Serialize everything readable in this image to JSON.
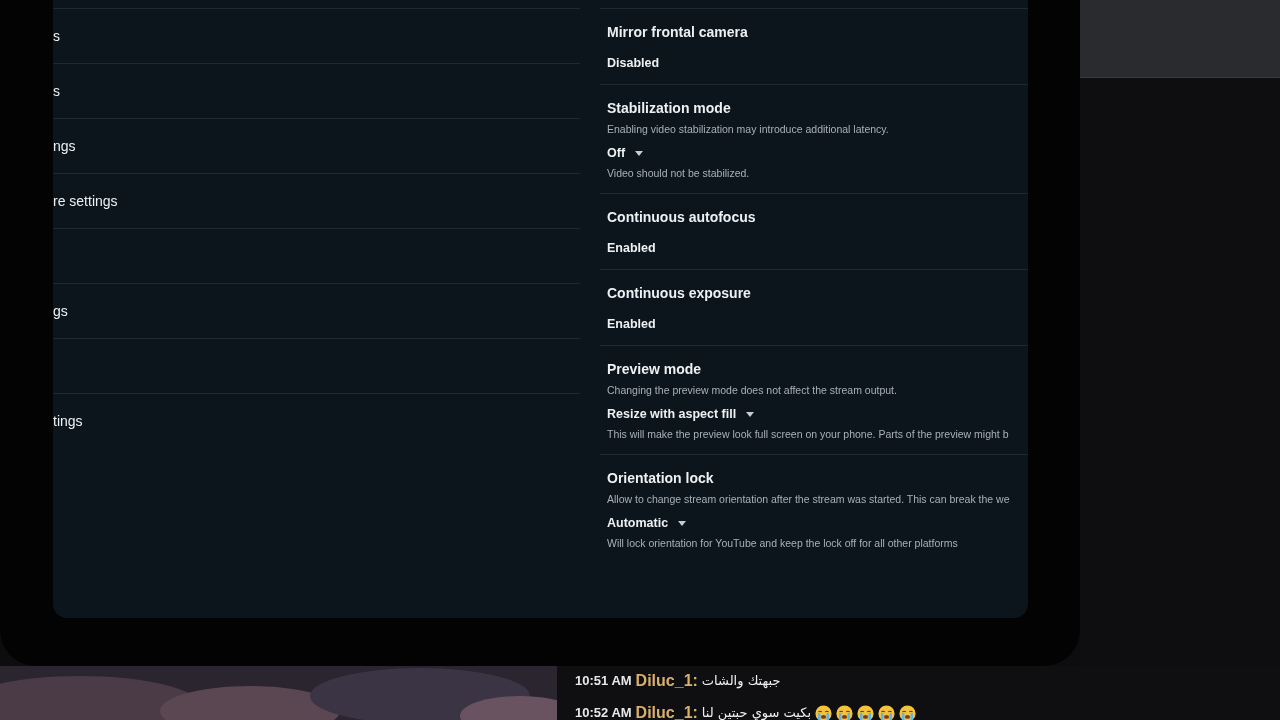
{
  "left_rows": [
    {
      "kind": "row",
      "title": "s"
    },
    {
      "kind": "row",
      "title": "s"
    },
    {
      "kind": "row",
      "title": "ngs"
    },
    {
      "kind": "row",
      "title": "re settings"
    },
    {
      "kind": "blank"
    },
    {
      "kind": "row",
      "title": "gs"
    },
    {
      "kind": "blank"
    },
    {
      "kind": "row",
      "title": "tings"
    }
  ],
  "settings": [
    {
      "title": "Mirror frontal camera",
      "value": "Disabled",
      "dropdown": false
    },
    {
      "title": "Stabilization mode",
      "description": "Enabling video stabilization may introduce additional latency.",
      "value": "Off",
      "dropdown": true,
      "note": "Video should not be stabilized."
    },
    {
      "title": "Continuous autofocus",
      "value": "Enabled",
      "dropdown": false
    },
    {
      "title": "Continuous exposure",
      "value": "Enabled",
      "dropdown": false
    },
    {
      "title": "Preview mode",
      "description": "Changing the preview mode does not affect the stream output.",
      "value": "Resize with aspect fill",
      "dropdown": true,
      "note": "This will make the preview look full screen on your phone. Parts of the preview might b"
    },
    {
      "title": "Orientation lock",
      "description": "Allow to change stream orientation after the stream was started. This can break the we",
      "value": "Automatic",
      "dropdown": true,
      "note": "Will lock orientation for YouTube and keep the lock off for all other platforms"
    }
  ],
  "chat": [
    {
      "time": "10:51 AM",
      "user": "Diluc_1:",
      "text": "جبهتك والشات"
    },
    {
      "time": "10:52 AM",
      "user": "Diluc_1:",
      "text": "بكيت سوي حبتين لنا",
      "emojis": [
        {
          "kind": "crying"
        },
        {
          "kind": "crying"
        },
        {
          "kind": "crying"
        },
        {
          "kind": "crying"
        },
        {
          "kind": "crying"
        }
      ]
    }
  ]
}
